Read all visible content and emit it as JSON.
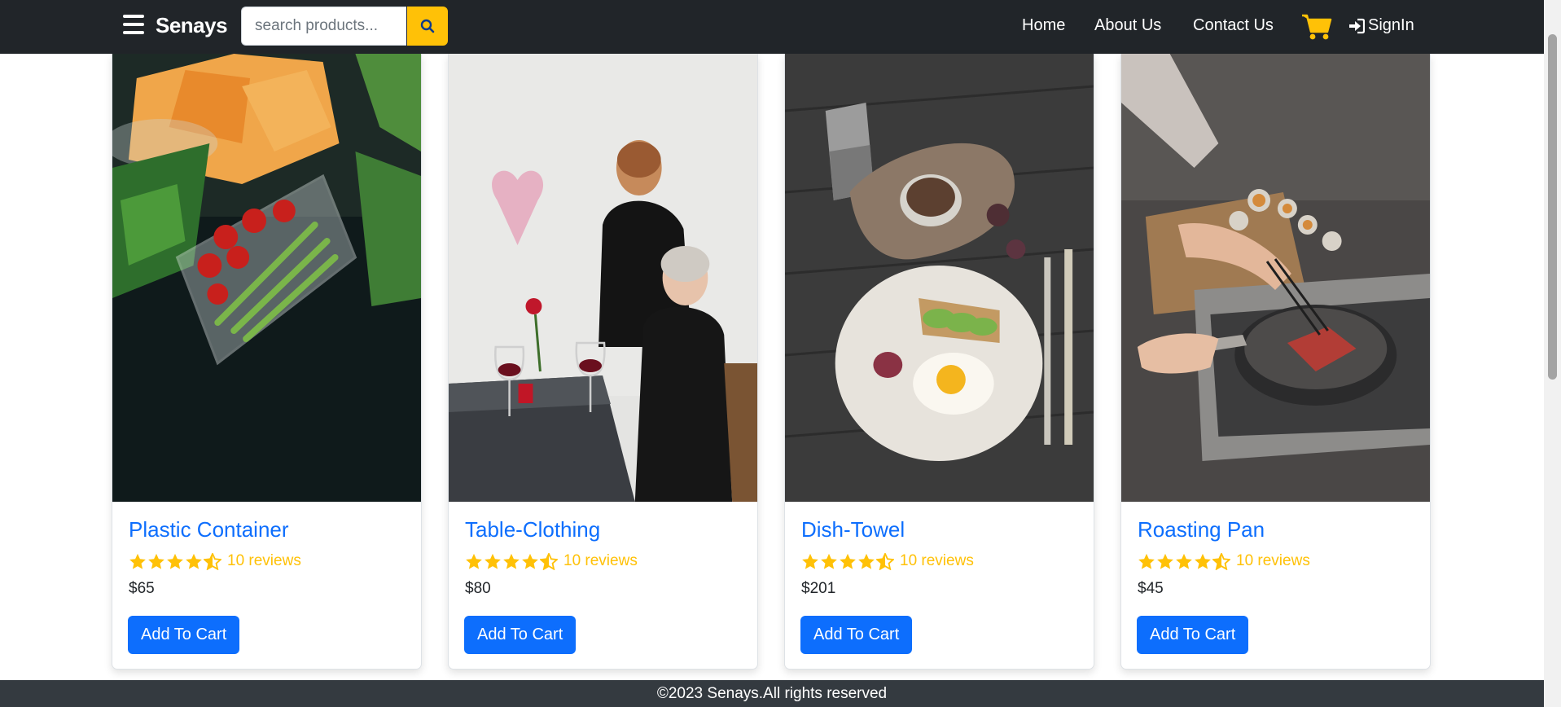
{
  "colors": {
    "navbar_bg": "#212529",
    "accent": "#ffc107",
    "primary": "#0d6efd",
    "footer_bg": "#343a40"
  },
  "navbar": {
    "brand": "Senays",
    "menu_icon": "hamburger-menu-icon",
    "search": {
      "placeholder": "search products...",
      "value": "",
      "button_icon": "search-icon"
    },
    "links": [
      {
        "label": "Home"
      },
      {
        "label": "About Us"
      },
      {
        "label": "Contact Us"
      }
    ],
    "cart_icon": "shopping-cart-icon",
    "signin": {
      "label": "SignIn",
      "icon": "sign-in-icon"
    }
  },
  "products": [
    {
      "name": "Plastic Container",
      "rating": 4.5,
      "reviews": "10 reviews",
      "price": "$65",
      "button": "Add To Cart",
      "image": "food-containers-photo"
    },
    {
      "name": "Table-Clothing",
      "rating": 4.5,
      "reviews": "10 reviews",
      "price": "$80",
      "button": "Add To Cart",
      "image": "dinner-table-photo"
    },
    {
      "name": "Dish-Towel",
      "rating": 4.5,
      "reviews": "10 reviews",
      "price": "$201",
      "button": "Add To Cart",
      "image": "breakfast-plate-photo"
    },
    {
      "name": "Roasting Pan",
      "rating": 4.5,
      "reviews": "10 reviews",
      "price": "$45",
      "button": "Add To Cart",
      "image": "cooking-steak-photo"
    }
  ],
  "footer": {
    "text": "©2023 Senays.All rights reserved"
  }
}
